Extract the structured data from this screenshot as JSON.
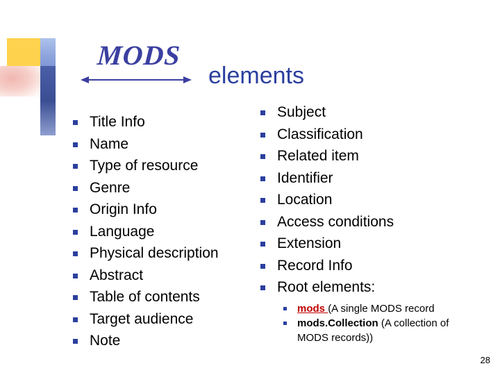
{
  "slide": {
    "title": "elements",
    "logo_text": "MODS",
    "page_number": "28"
  },
  "left_column": {
    "items": [
      "Title Info",
      "Name",
      "Type of resource",
      "Genre",
      "Origin Info",
      "Language",
      "Physical description",
      "Abstract",
      "Table of contents",
      "Target audience",
      "Note"
    ]
  },
  "right_column": {
    "items": [
      "Subject",
      "Classification",
      "Related item",
      "Identifier",
      "Location",
      "Access conditions",
      "Extension",
      "Record Info",
      "Root elements:"
    ],
    "sub_items": [
      {
        "link_text": "mods ",
        "rest_text": "(A single MODS record"
      },
      {
        "bold_text": "mods.Collection ",
        "rest_text": "(A collection of MODS records))"
      }
    ]
  },
  "colors": {
    "title_blue": "#2b3f9e",
    "bullet_blue": "#2b3f9e",
    "link_red": "#c00000",
    "logo_blue": "#3b3fa0"
  }
}
